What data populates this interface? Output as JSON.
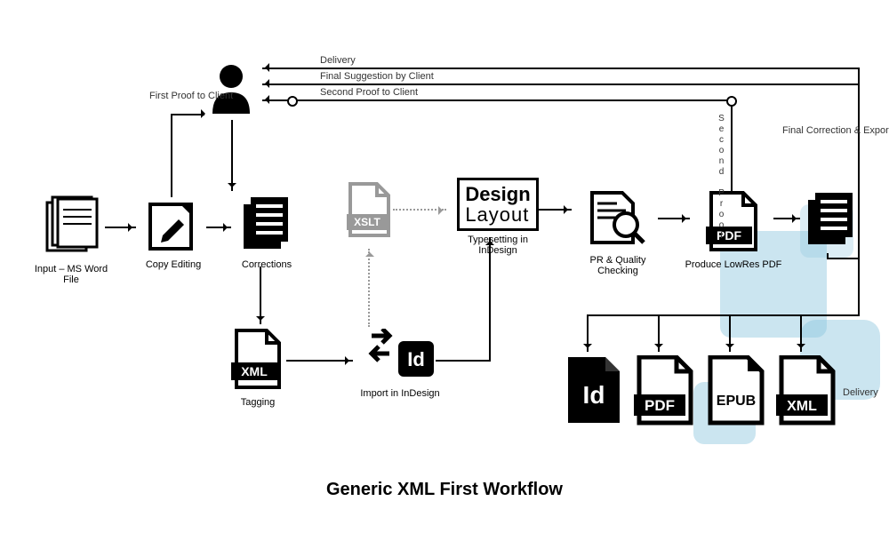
{
  "title": "Generic XML First Workflow",
  "nodes": {
    "input": "Input – MS Word File",
    "copy_editing": "Copy Editing",
    "corrections": "Corrections",
    "tagging": "Tagging",
    "xslt": "XSLT",
    "import_id": "Import in InDesign",
    "typesetting": "Typesetting in InDesign",
    "pr_qc": "PR & Quality Checking",
    "lowres_pdf": "Produce LowRes PDF",
    "design_layout_top": "Design",
    "design_layout_bottom": "Layout"
  },
  "flow_labels": {
    "first_proof": "First Proof to Client",
    "delivery_top": "Delivery",
    "final_suggestion": "Final Suggestion by Client",
    "second_proof_to_client": "Second Proof to Client",
    "second_proof": "Second Proof",
    "final_correction": "Final Correction & Export",
    "delivery_out": "Delivery"
  },
  "outputs": {
    "id": "Id",
    "pdf": "PDF",
    "epub": "EPUB",
    "xml": "XML"
  }
}
